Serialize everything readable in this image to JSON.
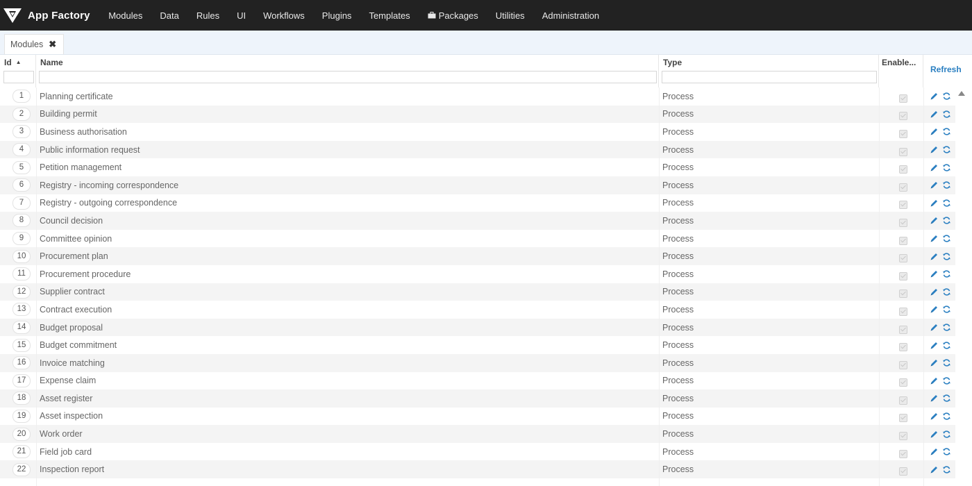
{
  "app": {
    "title": "App Factory"
  },
  "nav": [
    {
      "label": "Modules"
    },
    {
      "label": "Data"
    },
    {
      "label": "Rules"
    },
    {
      "label": "UI"
    },
    {
      "label": "Workflows"
    },
    {
      "label": "Plugins"
    },
    {
      "label": "Templates"
    },
    {
      "label": "Packages",
      "icon": "briefcase-icon"
    },
    {
      "label": "Utilities"
    },
    {
      "label": "Administration"
    }
  ],
  "tab": {
    "label": "Modules"
  },
  "grid": {
    "columns": {
      "id": "Id",
      "name": "Name",
      "type": "Type",
      "enabled": "Enable..."
    },
    "refresh_label": "Refresh",
    "sort": {
      "column": "id",
      "direction": "ascending"
    },
    "rows": [
      {
        "id": "1",
        "name": "Planning certificate",
        "type": "Process"
      },
      {
        "id": "2",
        "name": "Building permit",
        "type": "Process"
      },
      {
        "id": "3",
        "name": "Business authorisation",
        "type": "Process"
      },
      {
        "id": "4",
        "name": "Public information request",
        "type": "Process"
      },
      {
        "id": "5",
        "name": "Petition management",
        "type": "Process"
      },
      {
        "id": "6",
        "name": "Registry - incoming correspondence",
        "type": "Process"
      },
      {
        "id": "7",
        "name": "Registry - outgoing correspondence",
        "type": "Process"
      },
      {
        "id": "8",
        "name": "Council decision",
        "type": "Process"
      },
      {
        "id": "9",
        "name": "Committee opinion",
        "type": "Process"
      },
      {
        "id": "10",
        "name": "Procurement plan",
        "type": "Process"
      },
      {
        "id": "11",
        "name": "Procurement procedure",
        "type": "Process"
      },
      {
        "id": "12",
        "name": "Supplier contract",
        "type": "Process"
      },
      {
        "id": "13",
        "name": "Contract execution",
        "type": "Process"
      },
      {
        "id": "14",
        "name": "Budget proposal",
        "type": "Process"
      },
      {
        "id": "15",
        "name": "Budget commitment",
        "type": "Process"
      },
      {
        "id": "16",
        "name": "Invoice matching",
        "type": "Process"
      },
      {
        "id": "17",
        "name": "Expense claim",
        "type": "Process"
      },
      {
        "id": "18",
        "name": "Asset register",
        "type": "Process"
      },
      {
        "id": "19",
        "name": "Asset inspection",
        "type": "Process"
      },
      {
        "id": "20",
        "name": "Work order",
        "type": "Process"
      },
      {
        "id": "21",
        "name": "Field job card",
        "type": "Process"
      },
      {
        "id": "22",
        "name": "Inspection report",
        "type": "Process"
      }
    ]
  },
  "colors": {
    "topbar": "#222222",
    "accent": "#2a7fc1",
    "tabstrip": "#eef4fb"
  }
}
